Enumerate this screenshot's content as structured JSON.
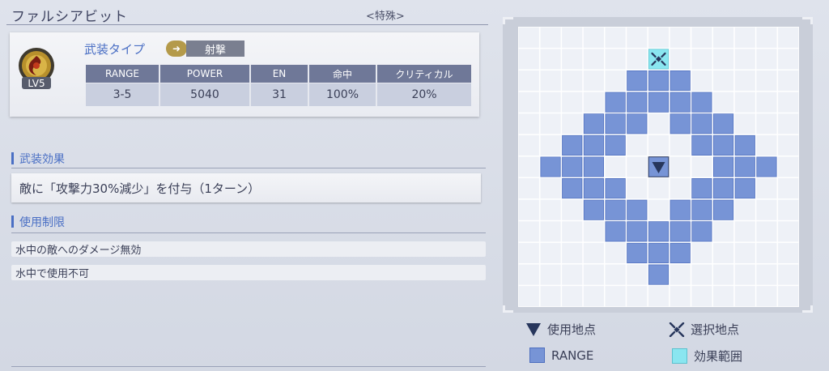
{
  "header": {
    "weapon_name": "ファルシアビット",
    "category": "<特殊>"
  },
  "weapon": {
    "level": "LV5",
    "type_label": "武装タイプ",
    "type_value": "射撃",
    "stats": {
      "headers": [
        "RANGE",
        "POWER",
        "EN",
        "命中",
        "クリティカル"
      ],
      "values": [
        "3-5",
        "5040",
        "31",
        "100%",
        "20%"
      ]
    }
  },
  "effect": {
    "heading": "武装効果",
    "text": "敵に「攻撃力30%減少」を付与（1ターン）"
  },
  "restrictions": {
    "heading": "使用制限",
    "items": [
      "水中の敵へのダメージ無効",
      "水中で使用不可"
    ]
  },
  "range_grid": {
    "columns": 13,
    "rows": 13,
    "use_point": [
      6,
      6
    ],
    "selected_point": [
      6,
      1
    ],
    "effect_cells": [
      [
        6,
        1
      ]
    ],
    "range_cells": [
      [
        5,
        2
      ],
      [
        6,
        2
      ],
      [
        7,
        2
      ],
      [
        4,
        3
      ],
      [
        5,
        3
      ],
      [
        6,
        3
      ],
      [
        7,
        3
      ],
      [
        8,
        3
      ],
      [
        3,
        4
      ],
      [
        4,
        4
      ],
      [
        5,
        4
      ],
      [
        7,
        4
      ],
      [
        8,
        4
      ],
      [
        9,
        4
      ],
      [
        2,
        5
      ],
      [
        3,
        5
      ],
      [
        4,
        5
      ],
      [
        8,
        5
      ],
      [
        9,
        5
      ],
      [
        10,
        5
      ],
      [
        1,
        6
      ],
      [
        2,
        6
      ],
      [
        3,
        6
      ],
      [
        9,
        6
      ],
      [
        10,
        6
      ],
      [
        11,
        6
      ],
      [
        2,
        7
      ],
      [
        3,
        7
      ],
      [
        4,
        7
      ],
      [
        8,
        7
      ],
      [
        9,
        7
      ],
      [
        10,
        7
      ],
      [
        3,
        8
      ],
      [
        4,
        8
      ],
      [
        5,
        8
      ],
      [
        7,
        8
      ],
      [
        8,
        8
      ],
      [
        9,
        8
      ],
      [
        4,
        9
      ],
      [
        5,
        9
      ],
      [
        6,
        9
      ],
      [
        7,
        9
      ],
      [
        8,
        9
      ],
      [
        5,
        10
      ],
      [
        6,
        10
      ],
      [
        7,
        10
      ],
      [
        6,
        11
      ]
    ],
    "colors": {
      "range": "#7794d6",
      "range_border": "#4e6fbf",
      "effect": "#8ae6f0",
      "use_point": "#27365c",
      "grid_bg": "#eef1f7",
      "grid_line": "#ffffff"
    }
  },
  "legend": {
    "use_point": "使用地点",
    "selected_point": "選択地点",
    "range": "RANGE",
    "effect_range": "効果範囲"
  }
}
